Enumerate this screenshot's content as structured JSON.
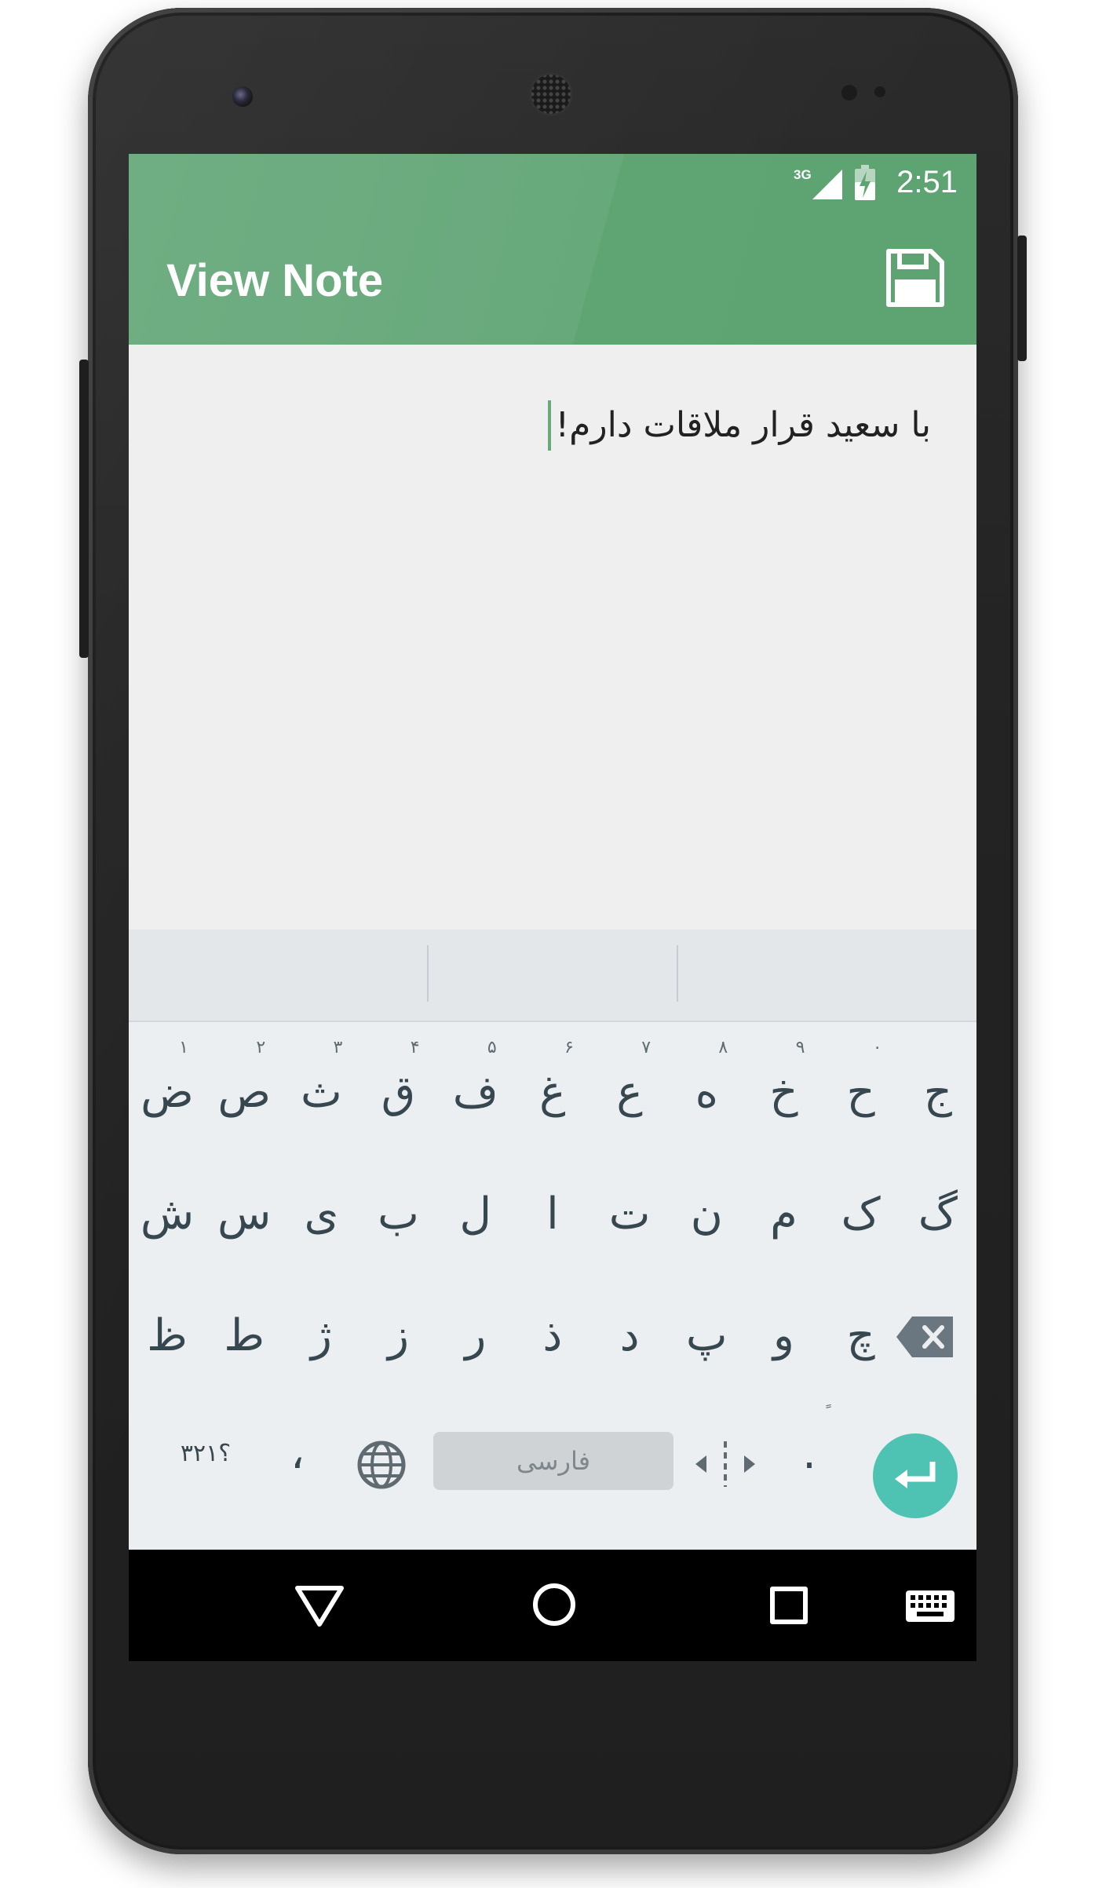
{
  "status_bar": {
    "network": "3G",
    "time": "2:51"
  },
  "app_bar": {
    "title": "View Note",
    "action_icon": "save-icon"
  },
  "note": {
    "text": "با سعید قرار ملاقات دارم!"
  },
  "keyboard": {
    "row1": [
      {
        "ch": "ض",
        "hint": "۱"
      },
      {
        "ch": "ص",
        "hint": "۲"
      },
      {
        "ch": "ث",
        "hint": "۳"
      },
      {
        "ch": "ق",
        "hint": "۴"
      },
      {
        "ch": "ف",
        "hint": "۵"
      },
      {
        "ch": "غ",
        "hint": "۶"
      },
      {
        "ch": "ع",
        "hint": "۷"
      },
      {
        "ch": "ه",
        "hint": "۸"
      },
      {
        "ch": "خ",
        "hint": "۹"
      },
      {
        "ch": "ح",
        "hint": "۰"
      },
      {
        "ch": "ج",
        "hint": ""
      }
    ],
    "row2": [
      "ش",
      "س",
      "ی",
      "ب",
      "ل",
      "ا",
      "ت",
      "ن",
      "م",
      "ک",
      "گ"
    ],
    "row3": [
      "ظ",
      "ط",
      "ژ",
      "ز",
      "ر",
      "ذ",
      "د",
      "پ",
      "و",
      "چ"
    ],
    "bottom": {
      "symbols_label": "؟۳۲۱",
      "comma": "،",
      "space_label": "فارسی",
      "period": ".",
      "period_hint": "ً"
    },
    "accent_color": "#4fc3b3"
  },
  "nav": {
    "back": "back-icon",
    "home": "home-icon",
    "recents": "recents-icon",
    "ime": "keyboard-switch-icon"
  },
  "colors": {
    "appbar": "#68a97c",
    "background": "#efefef"
  }
}
